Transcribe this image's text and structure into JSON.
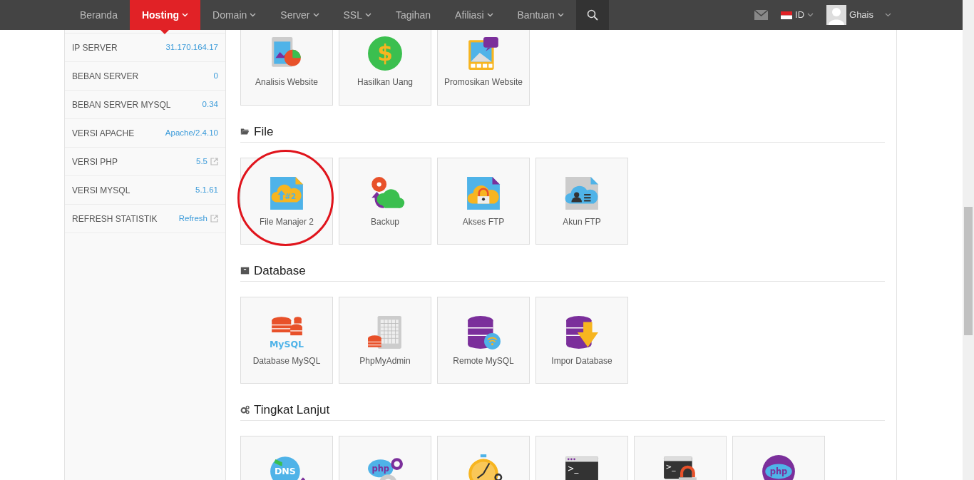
{
  "navbar": {
    "items": [
      {
        "label": "Beranda",
        "dropdown": false,
        "selected": false
      },
      {
        "label": "Hosting",
        "dropdown": true,
        "selected": true
      },
      {
        "label": "Domain",
        "dropdown": true,
        "selected": false
      },
      {
        "label": "Server",
        "dropdown": true,
        "selected": false
      },
      {
        "label": "SSL",
        "dropdown": true,
        "selected": false
      },
      {
        "label": "Tagihan",
        "dropdown": false,
        "selected": false
      },
      {
        "label": "Afiliasi",
        "dropdown": true,
        "selected": false
      },
      {
        "label": "Bantuan",
        "dropdown": true,
        "selected": false
      }
    ],
    "language": "ID",
    "user": "Ghais"
  },
  "sidebar": {
    "rows": [
      {
        "label": "IP SERVER",
        "value": "31.170.164.17",
        "external": false
      },
      {
        "label": "BEBAN SERVER",
        "value": "0",
        "external": false
      },
      {
        "label": "BEBAN SERVER MYSQL",
        "value": "0.34",
        "external": false
      },
      {
        "label": "VERSI APACHE",
        "value": "Apache/2.4.10",
        "external": false
      },
      {
        "label": "VERSI PHP",
        "value": "5.5",
        "external": true
      },
      {
        "label": "VERSI MYSQL",
        "value": "5.1.61",
        "external": false
      },
      {
        "label": "REFRESH STATISTIK",
        "value": "Refresh",
        "external": true
      }
    ]
  },
  "top_tiles": [
    {
      "label": "Analisis Website",
      "kind": "analytics",
      "highlighted": false
    },
    {
      "label": "Hasilkan Uang",
      "kind": "money",
      "icon_text": "$",
      "highlighted": false
    },
    {
      "label": "Promosikan Website",
      "kind": "promote",
      "highlighted": false
    }
  ],
  "sections": [
    {
      "title": "File",
      "kind": "folder",
      "tiles": [
        {
          "label": "File Manajer 2",
          "kind": "filemanager",
          "icon_text": "#2",
          "highlighted": true
        },
        {
          "label": "Backup",
          "kind": "backup",
          "highlighted": false
        },
        {
          "label": "Akses FTP",
          "kind": "ftp-access",
          "highlighted": false
        },
        {
          "label": "Akun FTP",
          "kind": "ftp-account",
          "highlighted": false
        }
      ]
    },
    {
      "title": "Database",
      "kind": "box",
      "tiles": [
        {
          "label": "Database MySQL",
          "kind": "mysql",
          "icon_text": "MySQL",
          "highlighted": false
        },
        {
          "label": "PhpMyAdmin",
          "kind": "phpmyadmin",
          "highlighted": false
        },
        {
          "label": "Remote MySQL",
          "kind": "remote-mysql",
          "highlighted": false
        },
        {
          "label": "Impor Database",
          "kind": "import-db",
          "highlighted": false
        }
      ]
    },
    {
      "title": "Tingkat Lanjut",
      "kind": "gears",
      "tiles": [
        {
          "kind": "dns",
          "icon_text": "DNS",
          "highlighted": false
        },
        {
          "kind": "php-config",
          "icon_text": "php",
          "highlighted": false
        },
        {
          "kind": "cron",
          "highlighted": false
        },
        {
          "kind": "ssh",
          "icon_text": ">_",
          "highlighted": false
        },
        {
          "kind": "ssh-lock",
          "icon_text": ">_",
          "highlighted": false
        },
        {
          "kind": "php",
          "icon_text": "php",
          "highlighted": false
        }
      ]
    }
  ]
}
